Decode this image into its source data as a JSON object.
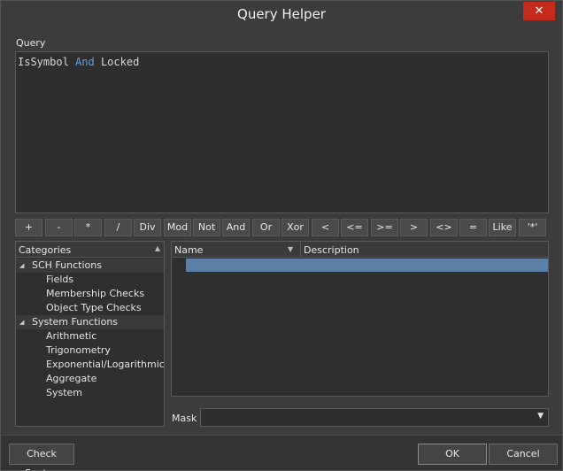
{
  "window": {
    "title": "Query Helper",
    "close_label": "✕"
  },
  "query": {
    "label": "Query",
    "tokens": {
      "t1": "IsSymbol",
      "t2": "And",
      "t3": "Locked"
    }
  },
  "operators": [
    "+",
    "-",
    "*",
    "/",
    "Div",
    "Mod",
    "Not",
    "And",
    "Or",
    "Xor",
    "<",
    "<=",
    ">=",
    ">",
    "<>",
    "=",
    "Like",
    "'*'"
  ],
  "categories": {
    "header": "Categories",
    "sort_icon": "▲",
    "groups": [
      {
        "label": "SCH Functions",
        "icon": "collapse-triangle",
        "items": [
          "Fields",
          "Membership Checks",
          "Object Type Checks"
        ]
      },
      {
        "label": "System Functions",
        "icon": "collapse-triangle",
        "items": [
          "Arithmetic",
          "Trigonometry",
          "Exponential/Logarithmic",
          "Aggregate",
          "System"
        ]
      }
    ]
  },
  "results": {
    "columns": {
      "name": "Name",
      "description": "Description"
    },
    "sort_icon": "▼",
    "selected_row_color": "#5b7fa6"
  },
  "mask": {
    "label": "Mask",
    "value": "",
    "dropdown_icon": "▼"
  },
  "footer": {
    "check_syntax": "Check Syntax",
    "ok": "OK",
    "cancel": "Cancel"
  },
  "colors": {
    "accent_keyword": "#5ea1e5",
    "close_button": "#c42b1c",
    "background": "#3c3c3c"
  }
}
